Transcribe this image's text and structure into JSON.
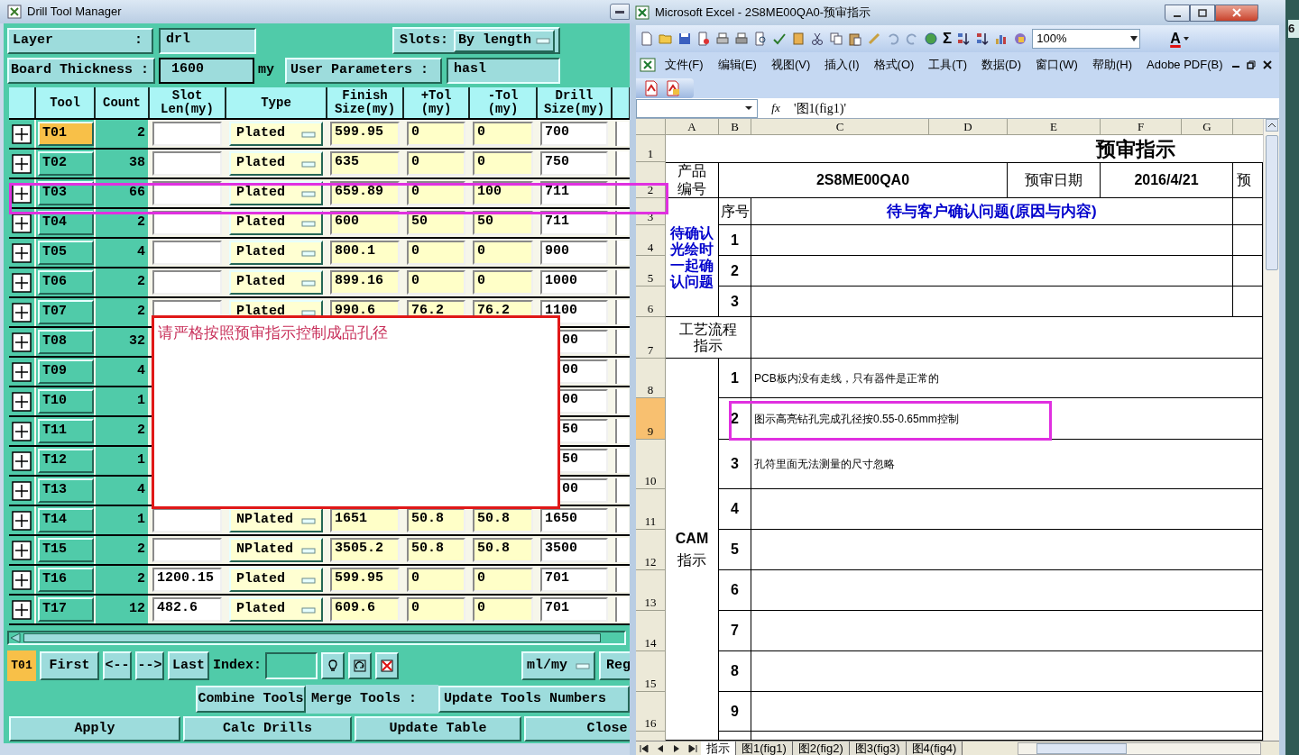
{
  "drill_tool_manager": {
    "title": "Drill Tool Manager",
    "layer_label": "Layer          :",
    "layer_value": "drl",
    "slots_label": "Slots:",
    "slots_value": "By length",
    "thickness_label": "Board Thickness :",
    "thickness_value": "1600",
    "thickness_unit": "my",
    "user_params_label": "User Parameters :",
    "user_params_value": "hasl",
    "columns": [
      "Tool",
      "Count",
      "Slot\nLen(my)",
      "Type",
      "Finish\nSize(my)",
      "+Tol\n(my)",
      "-Tol\n(my)",
      "Drill\nSize(my)"
    ],
    "rows": [
      {
        "tool": "T01",
        "selected": true,
        "covered": false,
        "count": "2",
        "type": "Plated",
        "finish": "599.95",
        "plus_tol": "0",
        "minus_tol": "0",
        "drill": "700"
      },
      {
        "tool": "T02",
        "selected": false,
        "covered": false,
        "count": "38",
        "type": "Plated",
        "finish": "635",
        "plus_tol": "0",
        "minus_tol": "0",
        "drill": "750"
      },
      {
        "tool": "T03",
        "selected": false,
        "covered": false,
        "count": "66",
        "type": "Plated",
        "finish": "659.89",
        "plus_tol": "0",
        "minus_tol": "100",
        "drill": "711"
      },
      {
        "tool": "T04",
        "selected": false,
        "covered": false,
        "count": "2",
        "type": "Plated",
        "finish": "600",
        "plus_tol": "50",
        "minus_tol": "50",
        "drill": "711"
      },
      {
        "tool": "T05",
        "selected": false,
        "covered": false,
        "count": "4",
        "type": "Plated",
        "finish": "800.1",
        "plus_tol": "0",
        "minus_tol": "0",
        "drill": "900"
      },
      {
        "tool": "T06",
        "selected": false,
        "covered": false,
        "count": "2",
        "type": "Plated",
        "finish": "899.16",
        "plus_tol": "0",
        "minus_tol": "0",
        "drill": "1000"
      },
      {
        "tool": "T07",
        "selected": false,
        "covered": false,
        "count": "2",
        "type": "Plated",
        "finish": "990.6",
        "plus_tol": "76.2",
        "minus_tol": "76.2",
        "drill": "1100"
      },
      {
        "tool": "T08",
        "selected": false,
        "covered": true,
        "count": "32",
        "drill": "00"
      },
      {
        "tool": "T09",
        "selected": false,
        "covered": true,
        "count": "4",
        "drill": "00"
      },
      {
        "tool": "T10",
        "selected": false,
        "covered": true,
        "count": "1",
        "drill": "00"
      },
      {
        "tool": "T11",
        "selected": false,
        "covered": true,
        "count": "2",
        "drill": "50"
      },
      {
        "tool": "T12",
        "selected": false,
        "covered": true,
        "count": "1",
        "drill": "50"
      },
      {
        "tool": "T13",
        "selected": false,
        "covered": true,
        "count": "4",
        "drill": "00"
      },
      {
        "tool": "T14",
        "selected": false,
        "covered": false,
        "count": "1",
        "type": "NPlated",
        "finish": "1651",
        "plus_tol": "50.8",
        "minus_tol": "50.8",
        "drill": "1650"
      },
      {
        "tool": "T15",
        "selected": false,
        "covered": false,
        "count": "2",
        "type": "NPlated",
        "finish": "3505.2",
        "plus_tol": "50.8",
        "minus_tol": "50.8",
        "drill": "3500"
      },
      {
        "tool": "T16",
        "selected": false,
        "covered": false,
        "count": "2",
        "slot": "1200.15",
        "type": "Plated",
        "finish": "599.95",
        "plus_tol": "0",
        "minus_tol": "0",
        "drill": "701"
      },
      {
        "tool": "T17",
        "selected": false,
        "covered": false,
        "count": "12",
        "slot": "482.6",
        "type": "Plated",
        "finish": "609.6",
        "plus_tol": "0",
        "minus_tol": "0",
        "drill": "701"
      }
    ],
    "popup_text": "请严格按照预审指示控制成品孔径",
    "current_tool": "T01",
    "nav_buttons": [
      "First",
      "<--",
      "-->",
      "Last"
    ],
    "index_label": "Index:",
    "unit_select": "ml/my",
    "reg_button": "Reg",
    "combine_button": "Combine Tools",
    "merge_label": "Merge Tools :",
    "update_numbers_button": "Update Tools Numbers",
    "actions": [
      "Apply",
      "Calc Drills",
      "Update Table",
      "Close"
    ]
  },
  "excel": {
    "title": "Microsoft Excel - 2S8ME00QA0-预审指示",
    "sum_glyph": "Σ",
    "zoom": "100%",
    "font_color_glyph": "A",
    "menu": [
      "文件(F)",
      "编辑(E)",
      "视图(V)",
      "插入(I)",
      "格式(O)",
      "工具(T)",
      "数据(D)",
      "窗口(W)",
      "帮助(H)",
      "Adobe PDF(B)"
    ],
    "fx": "fx",
    "formula": "'图1(fig1)'",
    "columns": [
      "A",
      "B",
      "C",
      "D",
      "E",
      "F",
      "G"
    ],
    "rows": [
      {
        "label": "1",
        "selected": false
      },
      {
        "label": "2",
        "selected": false
      },
      {
        "label": "3",
        "selected": false
      },
      {
        "label": "4",
        "selected": false
      },
      {
        "label": "5",
        "selected": false
      },
      {
        "label": "6",
        "selected": false
      },
      {
        "label": "7",
        "selected": false
      },
      {
        "label": "8",
        "selected": false
      },
      {
        "label": "9",
        "selected": true
      },
      {
        "label": "10",
        "selected": false
      },
      {
        "label": "11",
        "selected": false
      },
      {
        "label": "12",
        "selected": false
      },
      {
        "label": "13",
        "selected": false
      },
      {
        "label": "14",
        "selected": false
      },
      {
        "label": "15",
        "selected": false
      },
      {
        "label": "16",
        "selected": false
      }
    ],
    "cells": [
      "预审指示",
      "产品编号",
      "2S8ME00QA0",
      "预审日期",
      "2016/4/21",
      "预",
      "待确认光绘时一起确认问题",
      "序号",
      "待与客户确认问题(原因与内容)",
      "1",
      "2",
      "3",
      "工艺流程指示",
      "**CAM**指示",
      "1",
      "PCB板内没有走线，只有器件是正常的",
      "2",
      "图示高亮钻孔完成孔径按0.55-0.65mm控制",
      "3",
      "孔符里面无法测量的尺寸忽略",
      "4",
      "5",
      "6",
      "7",
      "8",
      "9"
    ],
    "sheet_tabs": [
      {
        "label": "指示",
        "selected": true
      },
      {
        "label": "图1(fig1)",
        "selected": false
      },
      {
        "label": "图2(fig2)",
        "selected": false
      },
      {
        "label": "图3(fig3)",
        "selected": false
      },
      {
        "label": "图4(fig4)",
        "selected": false
      }
    ]
  },
  "edge_text": "6"
}
